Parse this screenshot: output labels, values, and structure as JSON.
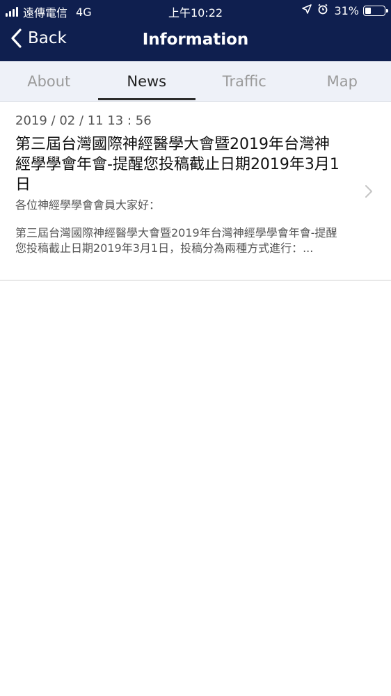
{
  "status_bar": {
    "carrier": "遠傳電信",
    "network": "4G",
    "time": "上午10:22",
    "battery": "31%",
    "battery_level": 0.31,
    "location_icon": "location-arrow-icon",
    "alarm_icon": "alarm-clock-icon"
  },
  "nav": {
    "back_label": "Back",
    "title": "Information"
  },
  "tabs": [
    {
      "label": "About",
      "active": false
    },
    {
      "label": "News",
      "active": true
    },
    {
      "label": "Traffic",
      "active": false
    },
    {
      "label": "Map",
      "active": false
    }
  ],
  "news": [
    {
      "date": "2019 / 02 / 11  13 : 56",
      "title": "第三屆台灣國際神經醫學大會暨2019年台灣神經學學會年會-提醒您投稿截止日期2019年3月1日",
      "greeting": "各位神經學學會會員大家好：",
      "summary": "第三屆台灣國際神經醫學大會暨2019年台灣神經學學會年會-提醒您投稿截止日期2019年3月1日，投稿分為兩種方式進行：..."
    }
  ],
  "colors": {
    "header_bg": "#0f1f4f",
    "tab_bg": "#eef1f8",
    "tab_active": "#222222",
    "tab_inactive": "#9a9a9a"
  }
}
